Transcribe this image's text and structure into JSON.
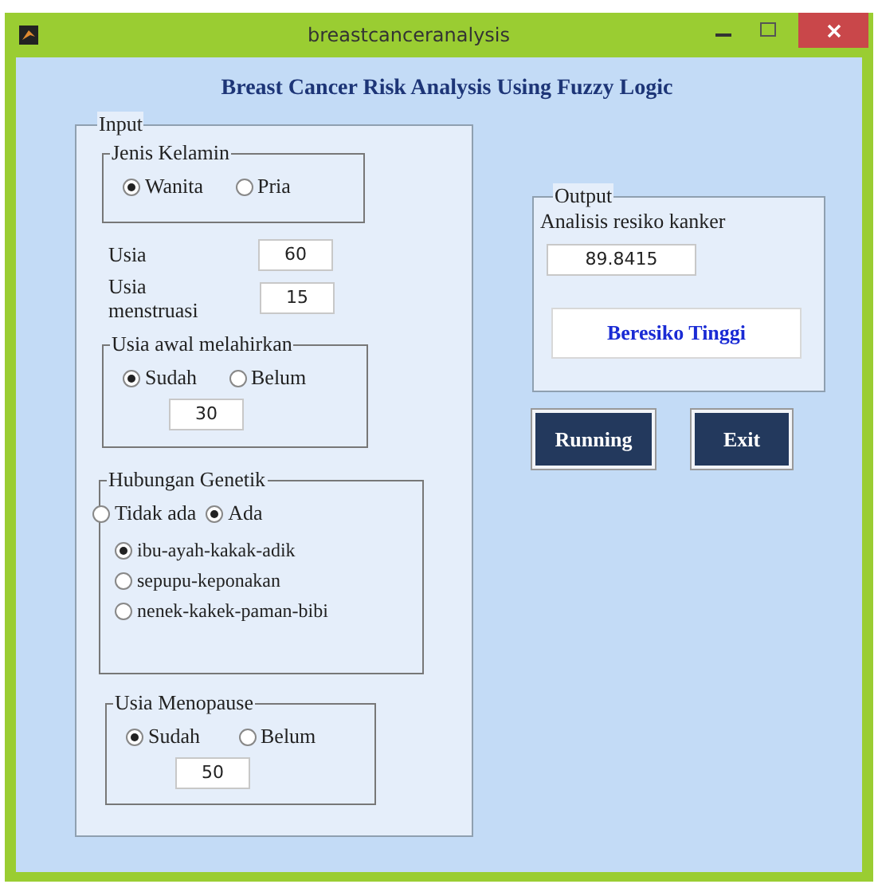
{
  "window": {
    "title": "breastcanceranalysis"
  },
  "heading": "Breast Cancer Risk Analysis Using Fuzzy Logic",
  "input": {
    "title": "Input",
    "gender": {
      "title": "Jenis Kelamin",
      "options": [
        {
          "label": "Wanita",
          "selected": true
        },
        {
          "label": "Pria",
          "selected": false
        }
      ]
    },
    "age": {
      "label": "Usia",
      "value": "60"
    },
    "menarche": {
      "label": "Usia menstruasi",
      "value": "15"
    },
    "first_birth": {
      "title": "Usia awal melahirkan",
      "options": [
        {
          "label": "Sudah",
          "selected": true
        },
        {
          "label": "Belum",
          "selected": false
        }
      ],
      "value": "30"
    },
    "genetic": {
      "title": "Hubungan Genetik",
      "options": [
        {
          "label": "Tidak ada",
          "selected": false
        },
        {
          "label": "Ada",
          "selected": true
        }
      ],
      "relations": [
        {
          "label": "ibu-ayah-kakak-adik",
          "selected": true
        },
        {
          "label": "sepupu-keponakan",
          "selected": false
        },
        {
          "label": "nenek-kakek-paman-bibi",
          "selected": false
        }
      ]
    },
    "menopause": {
      "title": "Usia Menopause",
      "options": [
        {
          "label": "Sudah",
          "selected": true
        },
        {
          "label": "Belum",
          "selected": false
        }
      ],
      "value": "50"
    }
  },
  "output": {
    "title": "Output",
    "label": "Analisis resiko kanker",
    "value": "89.8415",
    "result": "Beresiko Tinggi"
  },
  "buttons": [
    {
      "label": "Running"
    },
    {
      "label": "Exit"
    }
  ]
}
